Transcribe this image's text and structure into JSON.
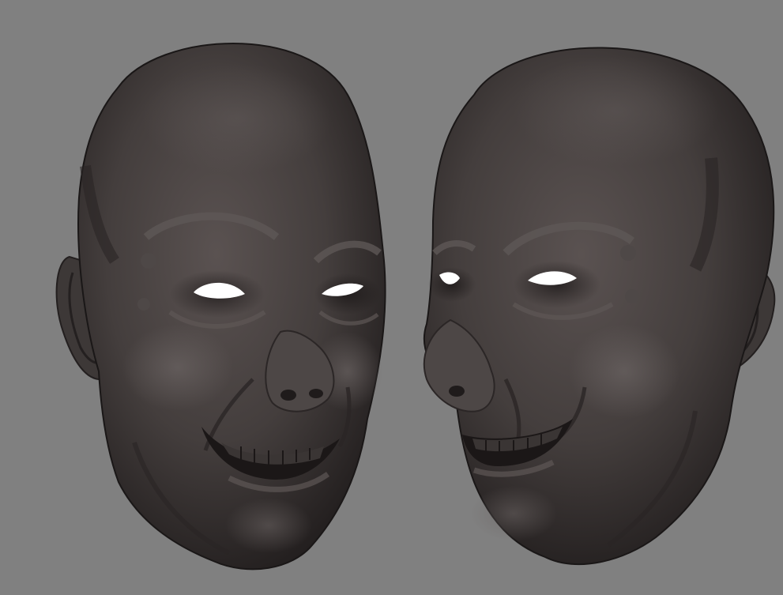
{
  "viewport": {
    "background_color": "#808080",
    "models": [
      {
        "name": "sculpt-head-left",
        "facing": "front-three-quarter-right"
      },
      {
        "name": "sculpt-head-right",
        "facing": "three-quarter-left"
      }
    ],
    "material_colors": {
      "skin_dark": "#2a2626",
      "skin_mid": "#4a4443",
      "skin_light": "#6b6463",
      "eye_white": "#ffffff",
      "teeth": "#3a3534"
    }
  }
}
